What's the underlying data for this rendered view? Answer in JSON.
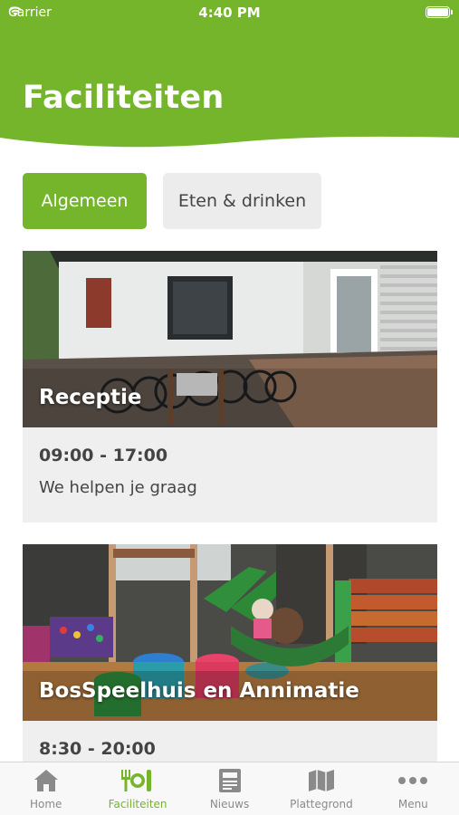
{
  "status_bar": {
    "carrier": "Carrier",
    "time": "4:40 PM"
  },
  "header": {
    "title": "Faciliteiten"
  },
  "segments": [
    {
      "label": "Algemeen",
      "active": true
    },
    {
      "label": "Eten & drinken",
      "active": false
    }
  ],
  "cards": [
    {
      "title": "Receptie",
      "hours": "09:00 - 17:00",
      "description": "We helpen je graag"
    },
    {
      "title": "BosSpeelhuis en Annimatie",
      "hours": "8:30 - 20:00",
      "description": ""
    }
  ],
  "tabbar": {
    "items": [
      {
        "label": "Home",
        "icon": "home-icon",
        "active": false
      },
      {
        "label": "Faciliteiten",
        "icon": "fork-knife-icon",
        "active": true
      },
      {
        "label": "Nieuws",
        "icon": "newspaper-icon",
        "active": false
      },
      {
        "label": "Plattegrond",
        "icon": "map-icon",
        "active": false
      },
      {
        "label": "Menu",
        "icon": "more-dots-icon",
        "active": false
      }
    ]
  },
  "colors": {
    "accent": "#74b52b",
    "card_background": "#efefef",
    "inactive_tab": "#8a8a8a"
  }
}
